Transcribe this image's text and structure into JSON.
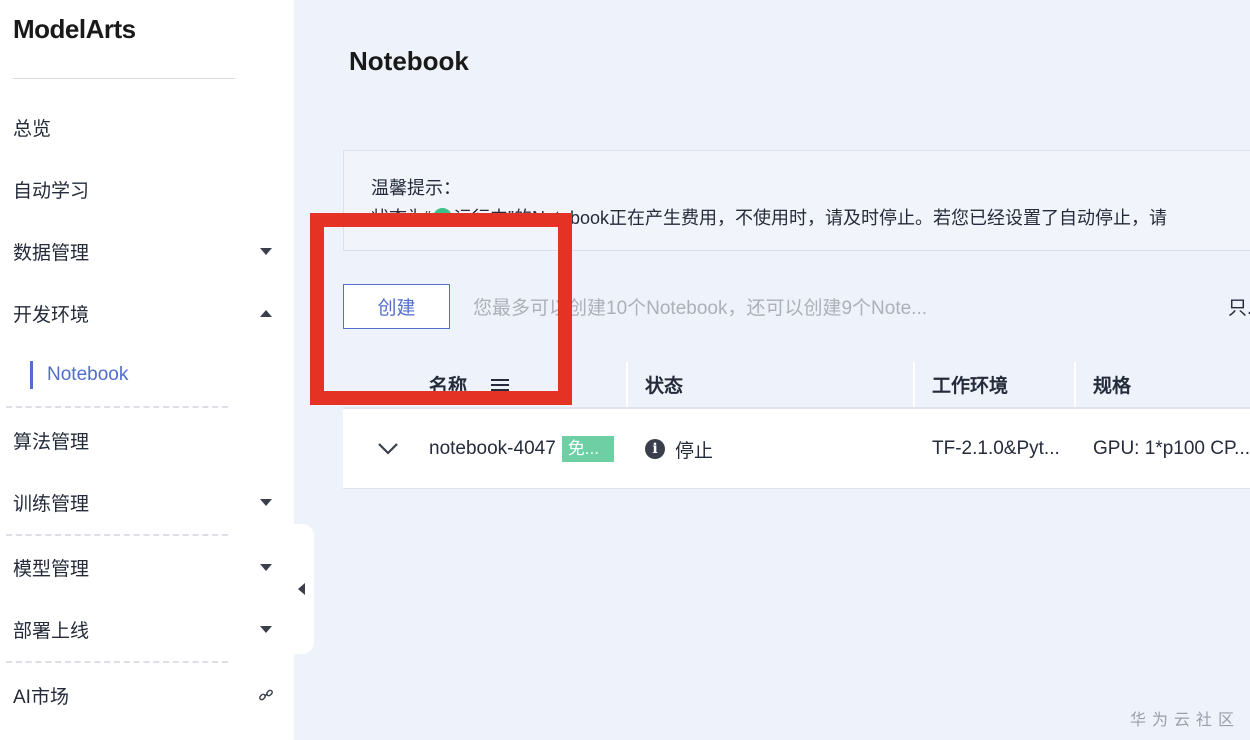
{
  "sidebar": {
    "brand": "ModelArts",
    "items": {
      "overview": "总览",
      "auto_learning": "自动学习",
      "data_management": "数据管理",
      "dev_environment": "开发环境",
      "notebook": "Notebook",
      "algorithm_management": "算法管理",
      "training_management": "训练管理",
      "model_management": "模型管理",
      "deployment": "部署上线",
      "ai_market": "AI市场"
    }
  },
  "page": {
    "title": "Notebook"
  },
  "notice": {
    "title": "温馨提示：",
    "line_prefix": "状态为“",
    "line_suffix": "运行中”的Notebook正在产生费用，不使用时，请及时停止。若您已经设置了自动停止，请"
  },
  "toolbar": {
    "create_label": "创建",
    "create_hint": "您最多可以创建10个Notebook，还可以创建9个Note...",
    "right_cut_text": "只."
  },
  "table": {
    "headers": {
      "name": "名称",
      "status": "状态",
      "environment": "工作环境",
      "spec": "规格"
    },
    "rows": [
      {
        "name": "notebook-4047",
        "badge": "免...",
        "status": "停止",
        "environment": "TF-2.1.0&Pyt...",
        "spec": "GPU: 1*p100 CP..."
      }
    ]
  },
  "footer": {
    "brand": "华为云社区"
  },
  "colors": {
    "accent": "#526ecc",
    "highlight": "#e43324",
    "running": "#3ec08b",
    "free_badge": "#6dcfa3",
    "page_bg": "#eef2fb"
  },
  "icons": {
    "collapse": "caret-left-icon",
    "link": "link-icon",
    "expand_row": "chevron-down-icon",
    "status": "info-icon",
    "filter": "filter-icon"
  }
}
